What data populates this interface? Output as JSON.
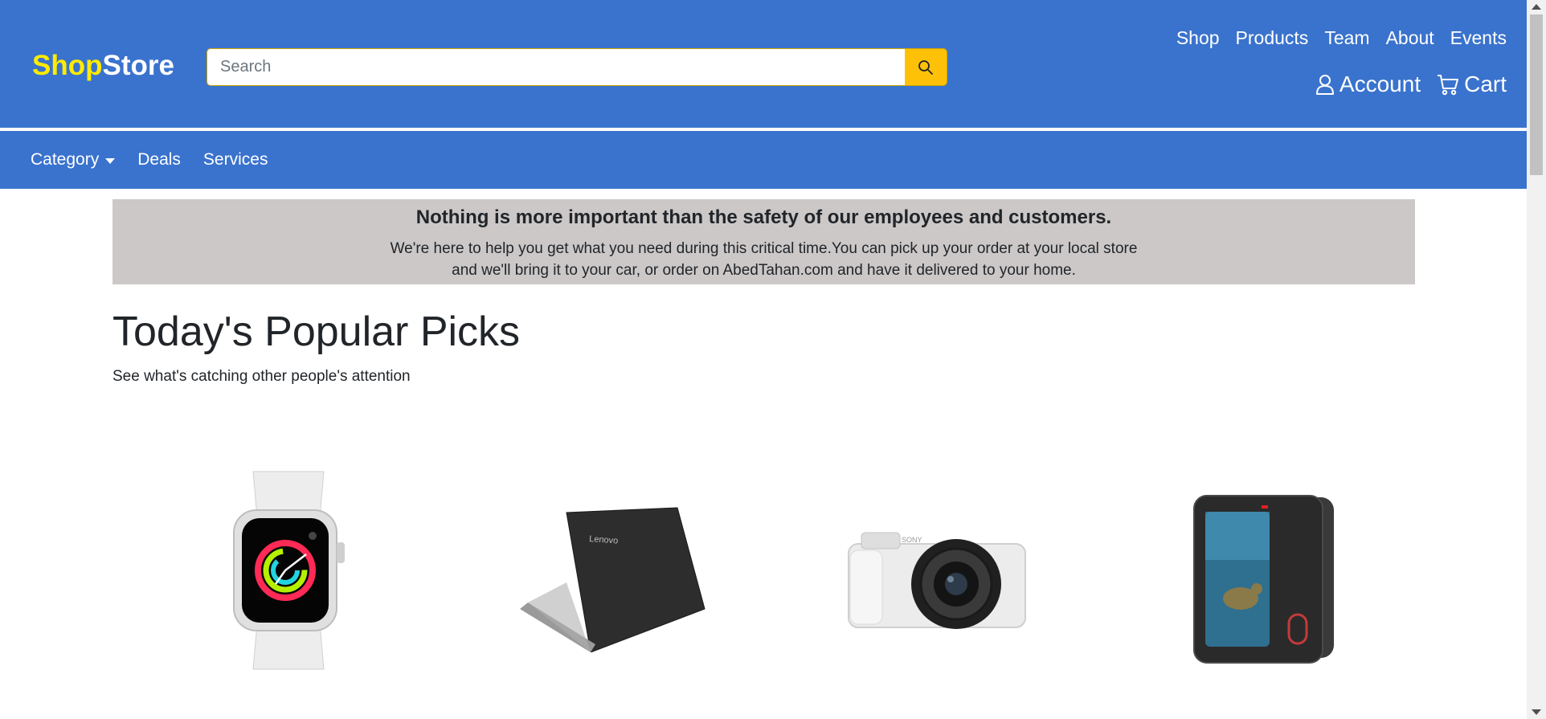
{
  "header": {
    "logo_part1": "Shop",
    "logo_part2": "Store",
    "search_placeholder": "Search",
    "nav_links": [
      "Shop",
      "Products",
      "Team",
      "About",
      "Events"
    ],
    "account_label": "Account",
    "cart_label": "Cart"
  },
  "subnav": {
    "category_label": "Category",
    "deals_label": "Deals",
    "services_label": "Services"
  },
  "notice": {
    "heading": "Nothing is more important than the safety of our employees and customers.",
    "body": "We're here to help you get what you need during this critical time.You can pick up your order at your local store and we'll bring it to your car, or order on AbedTahan.com and have it delivered to your home."
  },
  "picks": {
    "title": "Today's Popular Picks",
    "subtitle": "See what's catching other people's attention",
    "products": [
      {
        "icon": "smartwatch-image"
      },
      {
        "icon": "laptop-image",
        "brand_text": "Lenovo"
      },
      {
        "icon": "camera-image",
        "brand_text": "SONY"
      },
      {
        "icon": "action-camera-image"
      }
    ]
  },
  "colors": {
    "header_bg": "#3a73cd",
    "logo_accent": "#ffeb00",
    "search_button": "#ffc107",
    "notice_bg": "#ccc8c8"
  }
}
